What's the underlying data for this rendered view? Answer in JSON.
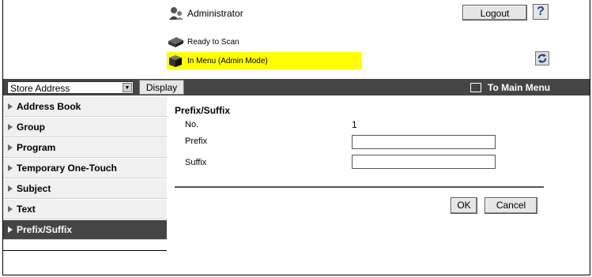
{
  "header": {
    "user_label": "Administrator",
    "logout_label": "Logout",
    "help_label": "?"
  },
  "status": {
    "ready": "Ready to Scan",
    "mode": "In Menu (Admin Mode)"
  },
  "toolbar": {
    "select_value": "Store Address",
    "display_label": "Display",
    "main_menu_label": "To Main Menu"
  },
  "sidebar": {
    "items": [
      {
        "label": "Address Book"
      },
      {
        "label": "Group"
      },
      {
        "label": "Program"
      },
      {
        "label": "Temporary One-Touch"
      },
      {
        "label": "Subject"
      },
      {
        "label": "Text"
      },
      {
        "label": "Prefix/Suffix"
      }
    ],
    "active_index": 6
  },
  "main": {
    "title": "Prefix/Suffix",
    "no_label": "No.",
    "no_value": "1",
    "prefix_label": "Prefix",
    "prefix_value": "",
    "suffix_label": "Suffix",
    "suffix_value": "",
    "ok_label": "OK",
    "cancel_label": "Cancel"
  },
  "colors": {
    "toolbar_bg": "#454545",
    "status_highlight": "#ffff00",
    "active_nav": "#454545"
  }
}
